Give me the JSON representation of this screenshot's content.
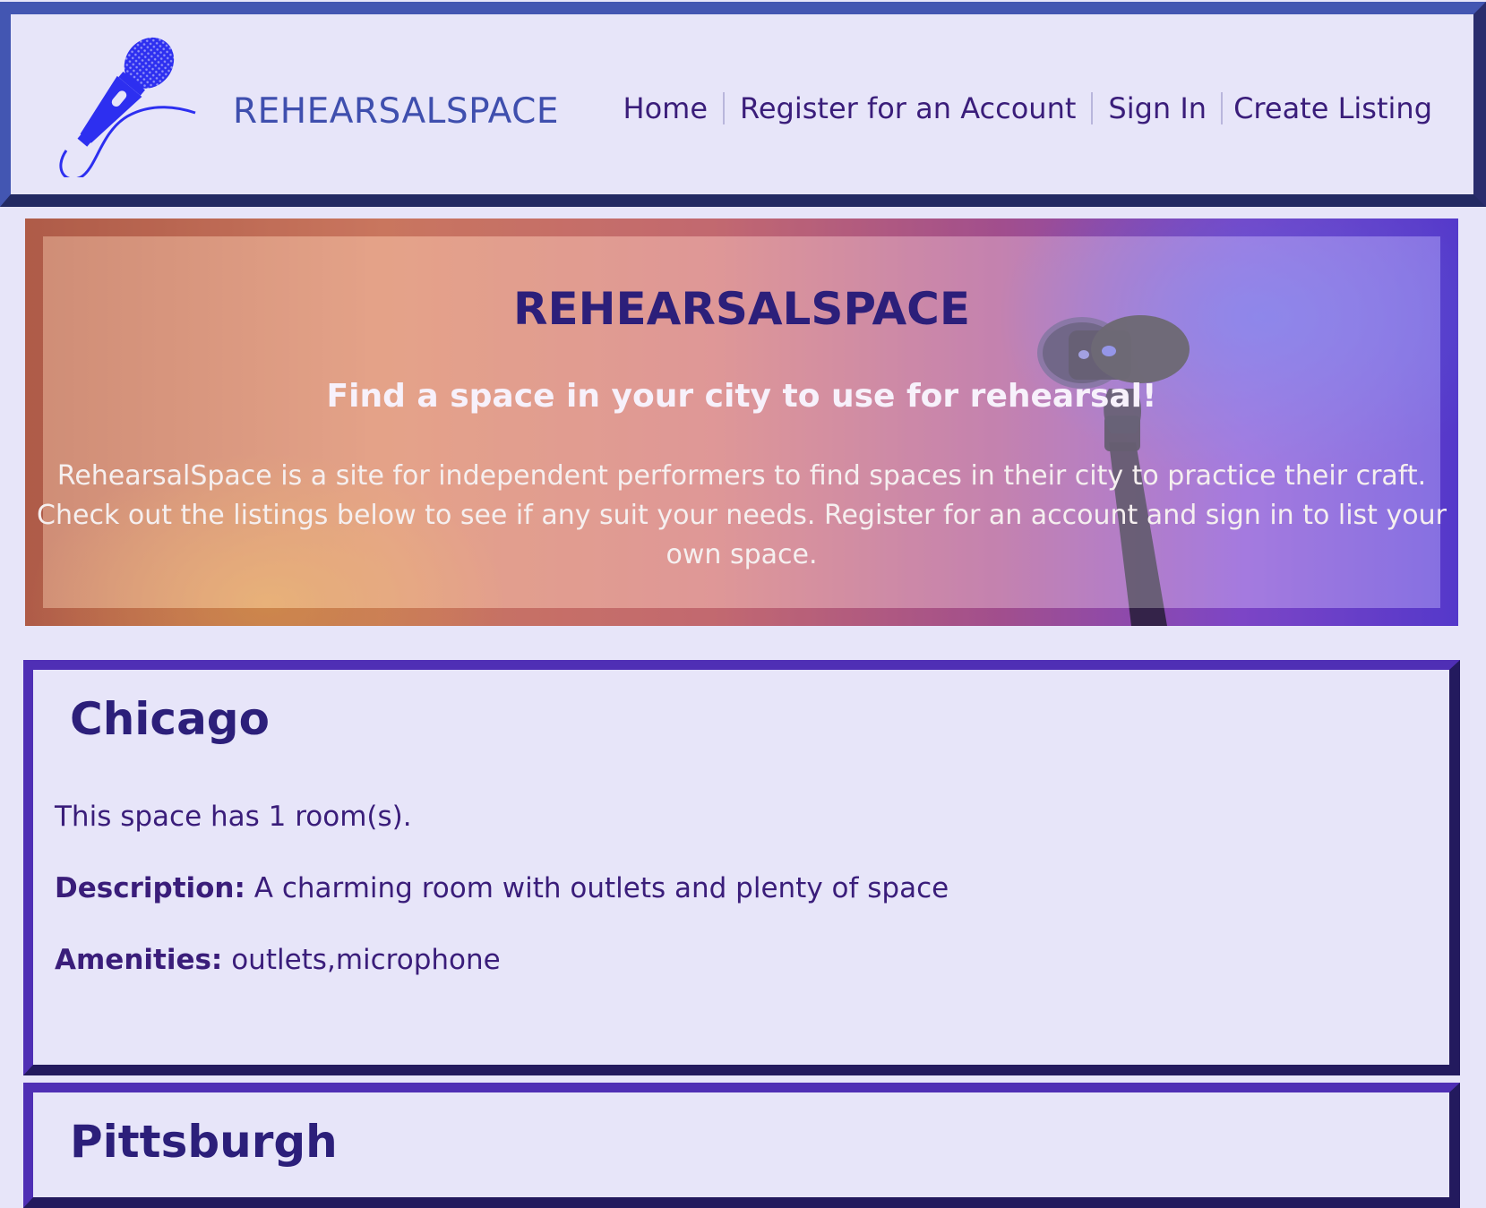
{
  "header": {
    "brand": "REHEARSALSPACE",
    "logo_icon": "microphone-icon",
    "nav": {
      "home": "Home",
      "register": "Register for an Account",
      "sign_in": "Sign In",
      "create_listing": "Create Listing"
    }
  },
  "hero": {
    "title": "REHEARSALSPACE",
    "subtitle": "Find a space in your city to use for rehearsal!",
    "description": "RehearsalSpace is a site for independent performers to find spaces in their city to practice their craft. Check out the listings below to see if any suit your needs. Register for an account and sign in to list your own space."
  },
  "listings": [
    {
      "city": "Chicago",
      "rooms_text": "This space has 1 room(s).",
      "description_label": "Description:",
      "description": "A charming room with outlets and plenty of space",
      "amenities_label": "Amenities:",
      "amenities": "outlets,microphone"
    },
    {
      "city": "Pittsburgh"
    }
  ],
  "colors": {
    "page_bg": "#e7e5f9",
    "brand_blue": "#3f4fae",
    "text_purple": "#3a1d7a",
    "heading_purple": "#2c1f7a",
    "logo_blue": "#2d2ff0"
  }
}
